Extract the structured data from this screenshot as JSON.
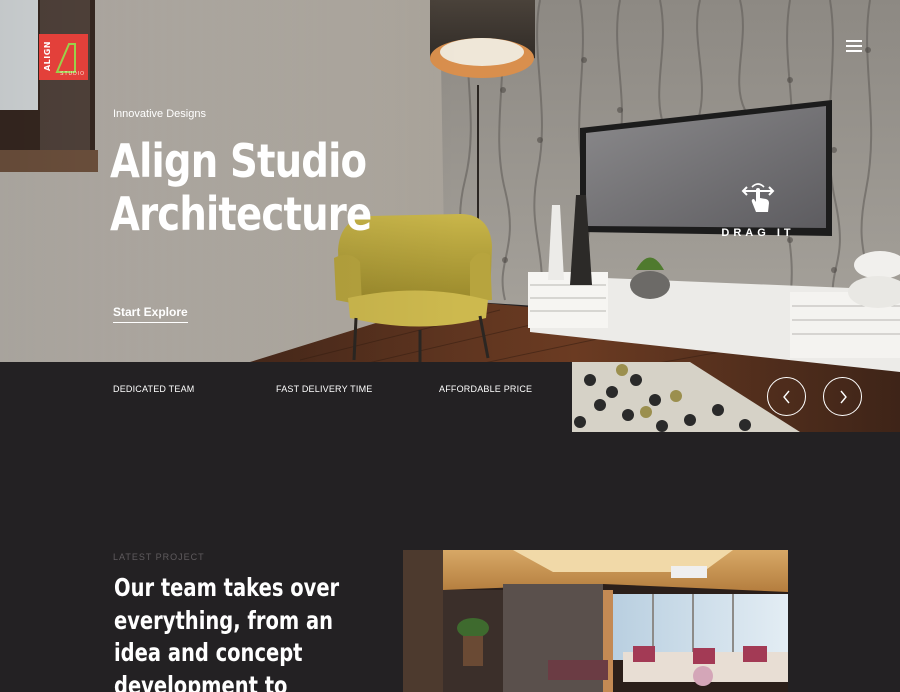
{
  "header": {
    "logo_text": "ALIGN",
    "logo_subtext": "STUDIO"
  },
  "hero": {
    "eyebrow": "Innovative Designs",
    "title_line1": "Align Studio",
    "title_line2": "Architecture",
    "cta": "Start Explore",
    "drag_label": "DRAG IT"
  },
  "features": [
    "DEDICATED TEAM",
    "FAST DELIVERY TIME",
    "AFFORDABLE PRICE"
  ],
  "project": {
    "kicker": "LATEST PROJECT",
    "headline_lines": [
      "Our team takes over",
      "everything, from an",
      "idea and concept",
      "development to"
    ]
  },
  "colors": {
    "brand": "#e3403a",
    "background": "#232123",
    "kicker": "#5f5b5e"
  },
  "icons": {
    "menu": "hamburger-icon",
    "drag": "swipe-hand-icon",
    "prev": "chevron-left-icon",
    "next": "chevron-right-icon"
  }
}
